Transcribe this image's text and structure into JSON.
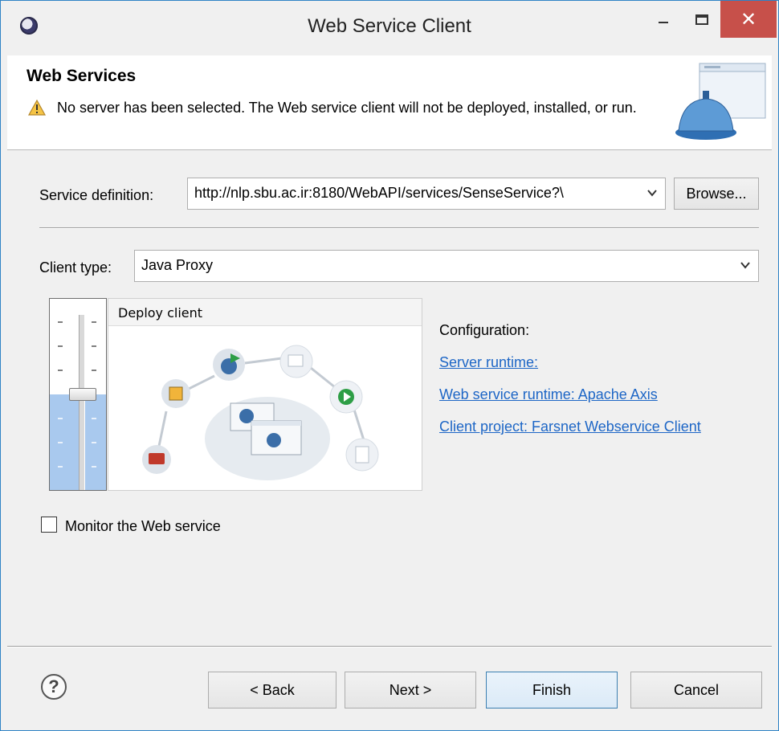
{
  "window": {
    "title": "Web Service Client"
  },
  "banner": {
    "title": "Web Services",
    "warning": "No server has been selected. The Web service client will not be deployed, installed, or run."
  },
  "service": {
    "label": "Service definition:",
    "value": "http://nlp.sbu.ac.ir:8180/WebAPI/services/SenseService?\\",
    "browse_label": "Browse..."
  },
  "client": {
    "label": "Client type:",
    "value": "Java Proxy"
  },
  "slider": {
    "level_label": "Deploy client",
    "fill_fraction": 0.5
  },
  "configuration": {
    "heading": "Configuration:",
    "server_runtime": "Server runtime: ",
    "web_service_runtime": "Web service runtime: Apache Axis",
    "client_project": "Client project: Farsnet Webservice Client"
  },
  "monitor": {
    "label": "Monitor the Web service",
    "checked": false
  },
  "footer": {
    "help": "?",
    "back": "< Back",
    "next": "Next >",
    "finish": "Finish",
    "cancel": "Cancel"
  },
  "colors": {
    "accent": "#1d66c6",
    "close": "#c7504a",
    "slider_fill": "#a9c9ee"
  }
}
